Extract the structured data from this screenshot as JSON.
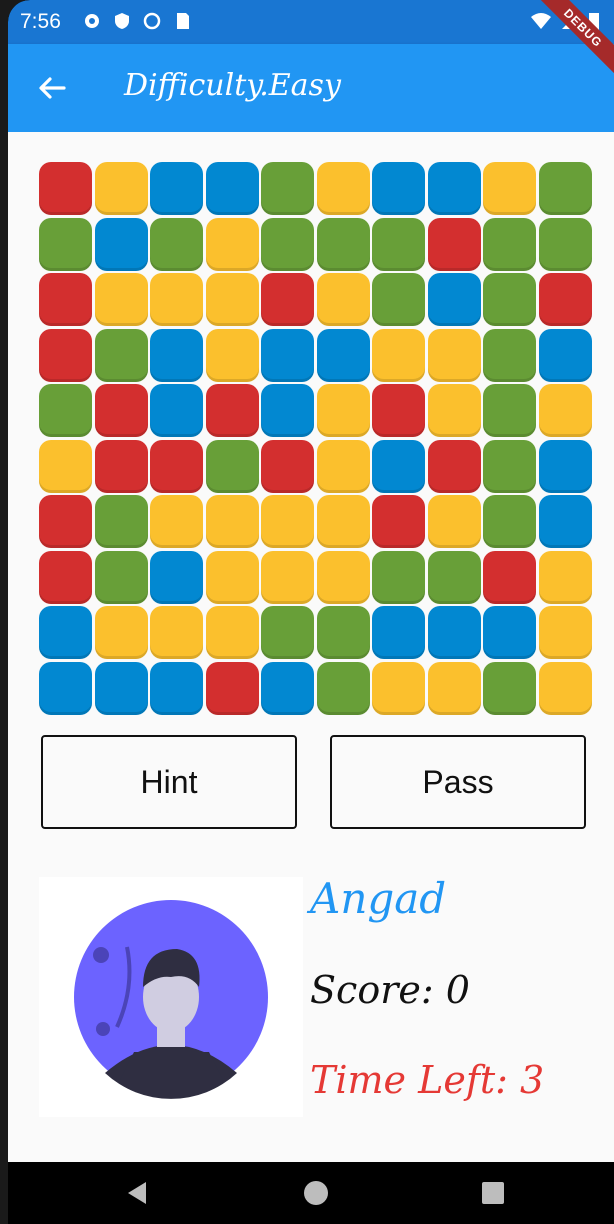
{
  "status": {
    "time": "7:56"
  },
  "debug_label": "DEBUG",
  "appbar": {
    "title": "Difficulty.Easy"
  },
  "colors": {
    "red": "#d32f2f",
    "yellow": "#fbc02d",
    "blue": "#0288d1",
    "green": "#689f38"
  },
  "board": [
    [
      "R",
      "Y",
      "B",
      "B",
      "G",
      "Y",
      "B",
      "B",
      "Y",
      "G"
    ],
    [
      "G",
      "B",
      "G",
      "Y",
      "G",
      "G",
      "G",
      "R",
      "G",
      "G"
    ],
    [
      "R",
      "Y",
      "Y",
      "Y",
      "R",
      "Y",
      "G",
      "B",
      "G",
      "R"
    ],
    [
      "R",
      "G",
      "B",
      "Y",
      "B",
      "B",
      "Y",
      "Y",
      "G",
      "B"
    ],
    [
      "G",
      "R",
      "B",
      "R",
      "B",
      "Y",
      "R",
      "Y",
      "G",
      "Y"
    ],
    [
      "Y",
      "R",
      "R",
      "G",
      "R",
      "Y",
      "B",
      "R",
      "G",
      "B"
    ],
    [
      "R",
      "G",
      "Y",
      "Y",
      "Y",
      "Y",
      "R",
      "Y",
      "G",
      "B"
    ],
    [
      "R",
      "G",
      "B",
      "Y",
      "Y",
      "Y",
      "G",
      "G",
      "R",
      "Y"
    ],
    [
      "B",
      "Y",
      "Y",
      "Y",
      "G",
      "G",
      "B",
      "B",
      "B",
      "Y"
    ],
    [
      "B",
      "B",
      "B",
      "R",
      "B",
      "G",
      "Y",
      "Y",
      "G",
      "Y"
    ]
  ],
  "buttons": {
    "hint": "Hint",
    "pass": "Pass"
  },
  "player": {
    "name": "Angad",
    "score": "Score: 0",
    "time_left": "Time Left: 3"
  }
}
